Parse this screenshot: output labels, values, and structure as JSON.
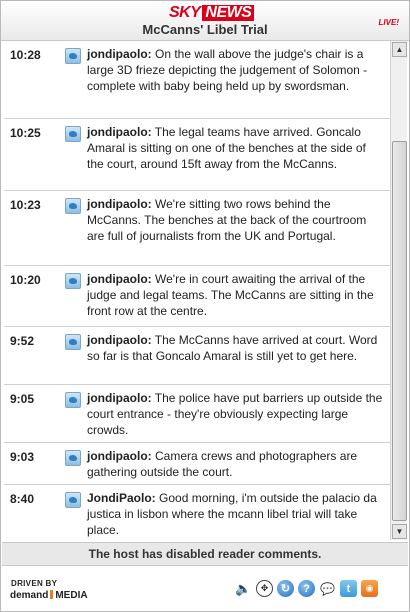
{
  "header": {
    "brand_sky": "SKY",
    "brand_news": "NEWS",
    "title": "McCanns' Libel Trial",
    "live": "LIVE!"
  },
  "entries": [
    {
      "time": "10:28",
      "author": "jondipaolo:",
      "text": "On the wall above the judge's chair is a large 3D frieze depicting the judgement of Solomon - complete with baby being held up by swordsman."
    },
    {
      "time": "10:25",
      "author": "jondipaolo:",
      "text": "The legal teams have arrived. Goncalo Amaral is sitting on one of the benches at the side of the court, around 15ft away from the McCanns."
    },
    {
      "time": "10:23",
      "author": "jondipaolo:",
      "text": "We're sitting two rows behind the McCanns. The benches at the back of the courtroom are full of journalists from the UK and Portugal."
    },
    {
      "time": "10:20",
      "author": "jondipaolo:",
      "text": "We're in court awaiting the arrival of the judge and legal teams. The McCanns are sitting in the front row at the centre."
    },
    {
      "time": "9:52",
      "author": "jondipaolo:",
      "text": "The McCanns have arrived at court. Word so far is that Goncalo Amaral is still yet to get here."
    },
    {
      "time": "9:05",
      "author": "jondipaolo:",
      "text": "The police have put barriers up outside the court entrance - they're obviously expecting large crowds."
    },
    {
      "time": "9:03",
      "author": "jondipaolo:",
      "text": "Camera crews and photographers are gathering outside the court."
    },
    {
      "time": "8:40",
      "author": "JondiPaolo:",
      "text": "Good morning, i'm outside the palacio da justica in lisbon where the mcann libel trial will take place."
    }
  ],
  "notice": "The host has disabled reader comments.",
  "footer": {
    "driven_by": "DRIVEN BY",
    "demand": "demand",
    "media": "MEDIA"
  },
  "icons": [
    "speaker-icon",
    "move-icon",
    "refresh-icon",
    "help-icon",
    "chat-icon",
    "twitter-icon",
    "rss-icon"
  ]
}
